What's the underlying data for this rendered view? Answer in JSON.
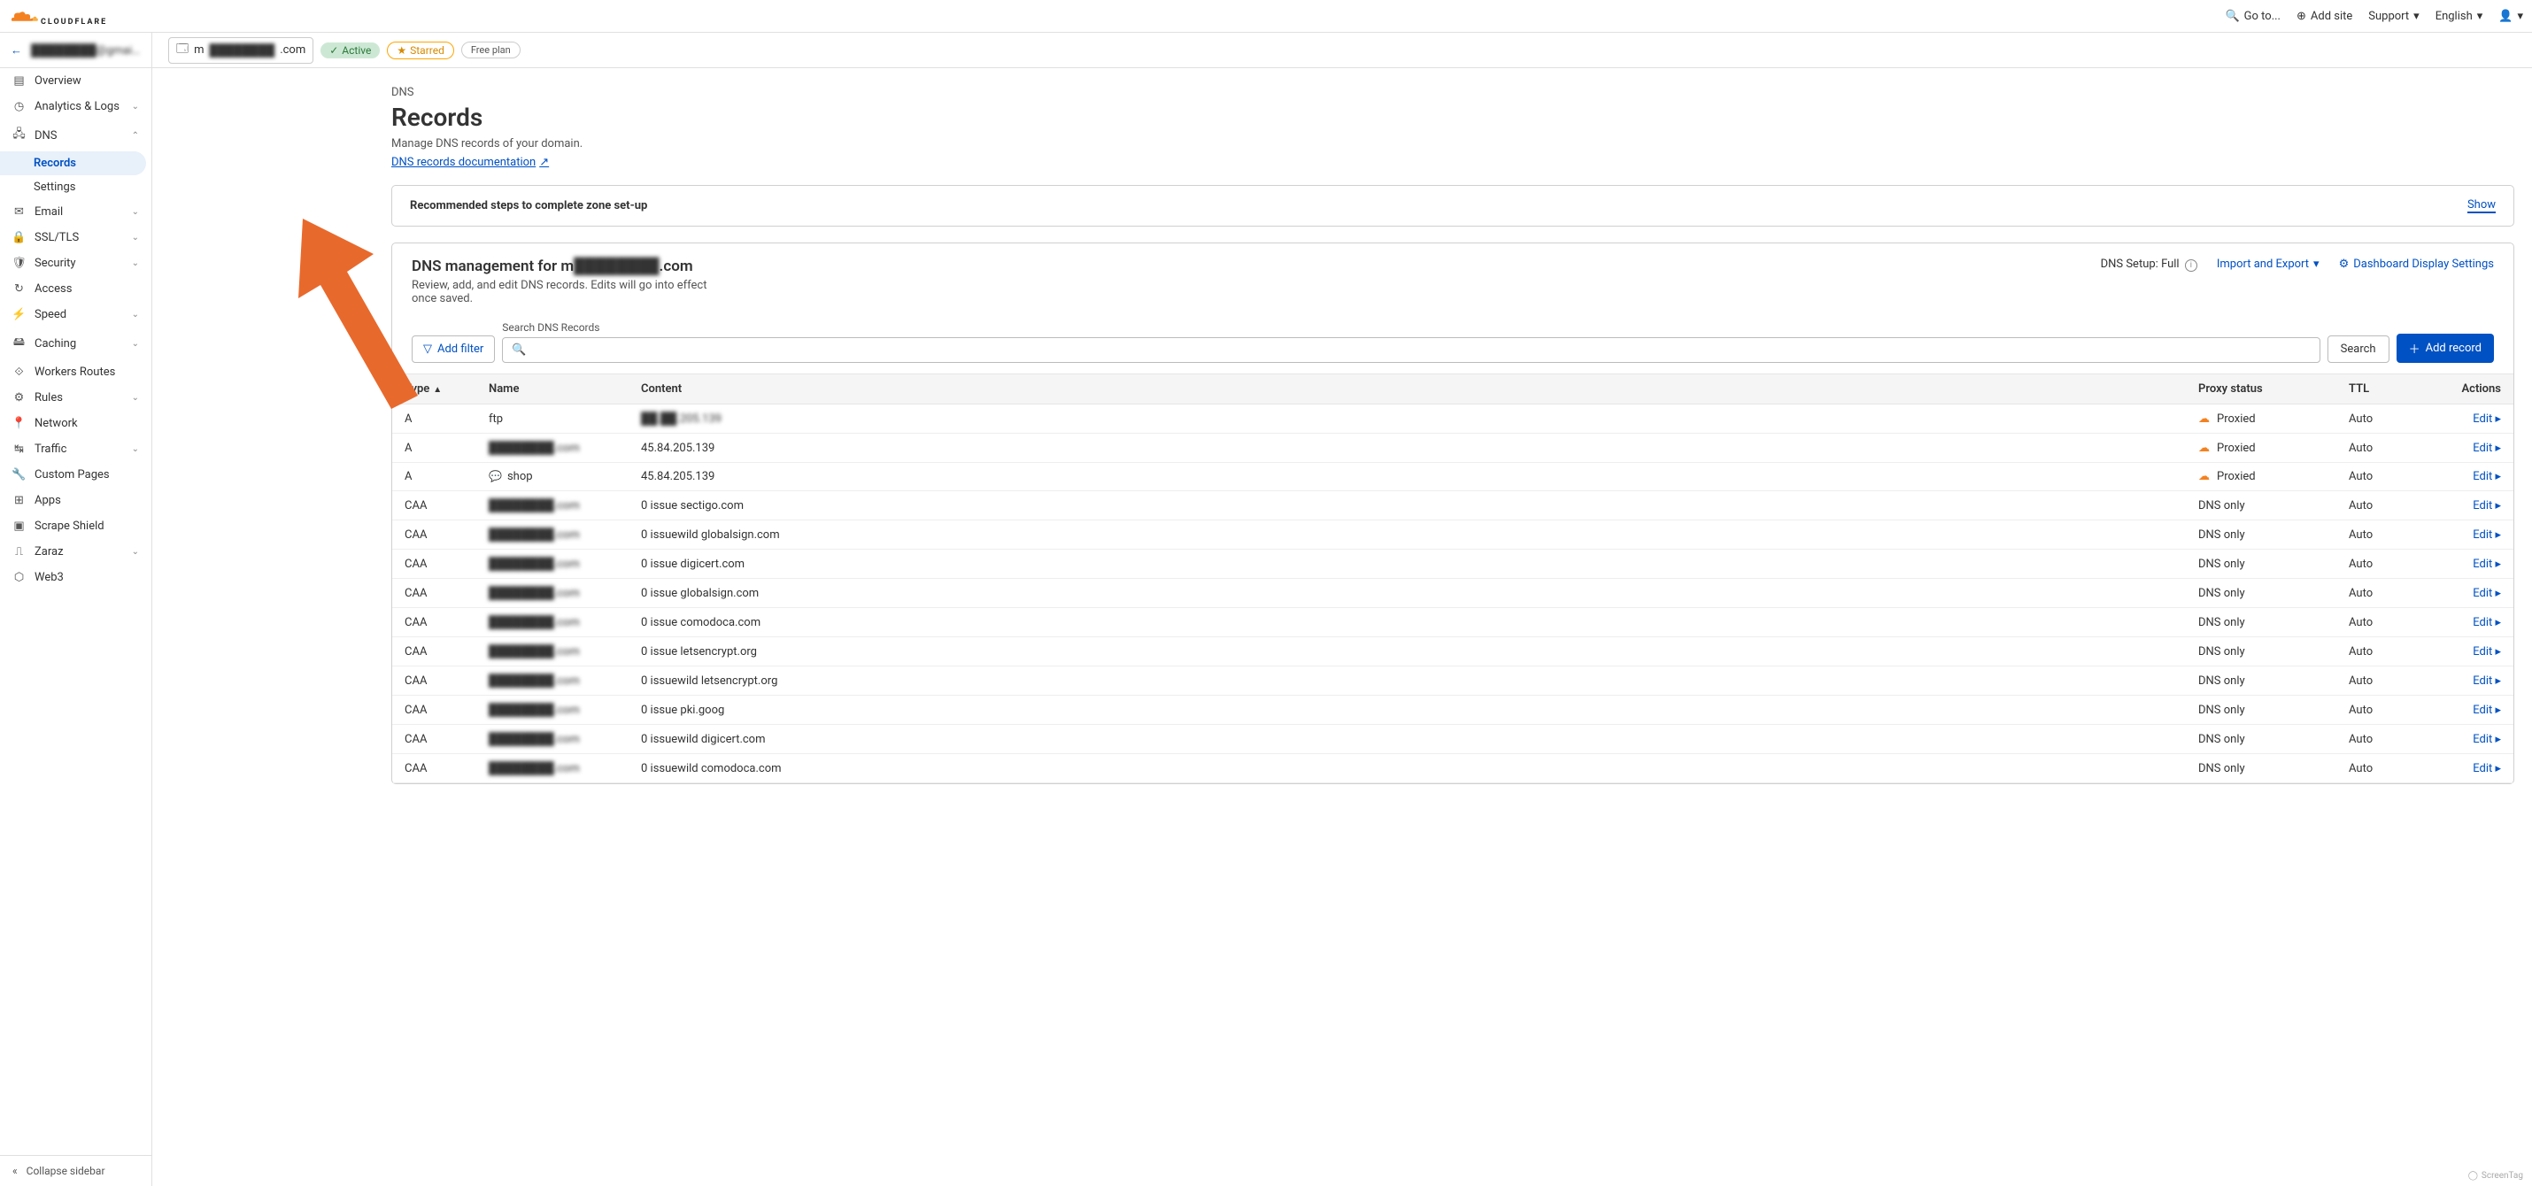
{
  "topbar": {
    "goto": "Go to...",
    "addsite": "Add site",
    "support": "Support",
    "language": "English"
  },
  "header": {
    "account": "████████@gmail....",
    "domain_prefix": "m",
    "domain_mid": "████████",
    "domain_suffix": ".com",
    "active": "Active",
    "starred": "Starred",
    "plan": "Free plan"
  },
  "sidebar": {
    "overview": "Overview",
    "analytics": "Analytics & Logs",
    "dns": "DNS",
    "dns_records": "Records",
    "dns_settings": "Settings",
    "email": "Email",
    "ssl": "SSL/TLS",
    "security": "Security",
    "access": "Access",
    "speed": "Speed",
    "caching": "Caching",
    "workers": "Workers Routes",
    "rules": "Rules",
    "network": "Network",
    "traffic": "Traffic",
    "custom_pages": "Custom Pages",
    "apps": "Apps",
    "scrape": "Scrape Shield",
    "zaraz": "Zaraz",
    "web3": "Web3",
    "collapse": "Collapse sidebar"
  },
  "page": {
    "breadcrumb": "DNS",
    "title": "Records",
    "subtitle": "Manage DNS records of your domain.",
    "doclink": "DNS records documentation",
    "recommended": "Recommended steps to complete zone set-up",
    "show": "Show"
  },
  "mgmt": {
    "title_prefix": "DNS management for m",
    "title_blur": "████████",
    "title_suffix": ".com",
    "sub": "Review, add, and edit DNS records. Edits will go into effect once saved.",
    "setup_label": "DNS Setup:",
    "setup_value": "Full",
    "import": "Import and Export",
    "display": "Dashboard Display Settings"
  },
  "filters": {
    "addfilter": "Add filter",
    "search_label": "Search DNS Records",
    "search": "Search",
    "addrecord": "Add record"
  },
  "table": {
    "th_type": "Type",
    "th_name": "Name",
    "th_content": "Content",
    "th_proxy": "Proxy status",
    "th_ttl": "TTL",
    "th_actions": "Actions",
    "edit": "Edit",
    "proxied": "Proxied",
    "dnsonly": "DNS only",
    "auto": "Auto",
    "rows": [
      {
        "type": "A",
        "name": "ftp",
        "name_blur": false,
        "has_comment": false,
        "content": "██.██.205.139",
        "content_blur": true,
        "proxy": "Proxied",
        "ttl": "Auto"
      },
      {
        "type": "A",
        "name": "████████.com",
        "name_blur": true,
        "has_comment": false,
        "content": "45.84.205.139",
        "content_blur": false,
        "proxy": "Proxied",
        "ttl": "Auto"
      },
      {
        "type": "A",
        "name": "shop",
        "name_blur": false,
        "has_comment": true,
        "content": "45.84.205.139",
        "content_blur": false,
        "proxy": "Proxied",
        "ttl": "Auto"
      },
      {
        "type": "CAA",
        "name": "████████.com",
        "name_blur": true,
        "has_comment": false,
        "content": "0 issue sectigo.com",
        "content_blur": false,
        "proxy": "DNS only",
        "ttl": "Auto"
      },
      {
        "type": "CAA",
        "name": "████████.com",
        "name_blur": true,
        "has_comment": false,
        "content": "0 issuewild globalsign.com",
        "content_blur": false,
        "proxy": "DNS only",
        "ttl": "Auto"
      },
      {
        "type": "CAA",
        "name": "████████.com",
        "name_blur": true,
        "has_comment": false,
        "content": "0 issue digicert.com",
        "content_blur": false,
        "proxy": "DNS only",
        "ttl": "Auto"
      },
      {
        "type": "CAA",
        "name": "████████.com",
        "name_blur": true,
        "has_comment": false,
        "content": "0 issue globalsign.com",
        "content_blur": false,
        "proxy": "DNS only",
        "ttl": "Auto"
      },
      {
        "type": "CAA",
        "name": "████████.com",
        "name_blur": true,
        "has_comment": false,
        "content": "0 issue comodoca.com",
        "content_blur": false,
        "proxy": "DNS only",
        "ttl": "Auto"
      },
      {
        "type": "CAA",
        "name": "████████.com",
        "name_blur": true,
        "has_comment": false,
        "content": "0 issue letsencrypt.org",
        "content_blur": false,
        "proxy": "DNS only",
        "ttl": "Auto"
      },
      {
        "type": "CAA",
        "name": "████████.com",
        "name_blur": true,
        "has_comment": false,
        "content": "0 issuewild letsencrypt.org",
        "content_blur": false,
        "proxy": "DNS only",
        "ttl": "Auto"
      },
      {
        "type": "CAA",
        "name": "████████.com",
        "name_blur": true,
        "has_comment": false,
        "content": "0 issue pki.goog",
        "content_blur": false,
        "proxy": "DNS only",
        "ttl": "Auto"
      },
      {
        "type": "CAA",
        "name": "████████.com",
        "name_blur": true,
        "has_comment": false,
        "content": "0 issuewild digicert.com",
        "content_blur": false,
        "proxy": "DNS only",
        "ttl": "Auto"
      },
      {
        "type": "CAA",
        "name": "████████.com",
        "name_blur": true,
        "has_comment": false,
        "content": "0 issuewild comodoca.com",
        "content_blur": false,
        "proxy": "DNS only",
        "ttl": "Auto"
      }
    ]
  }
}
